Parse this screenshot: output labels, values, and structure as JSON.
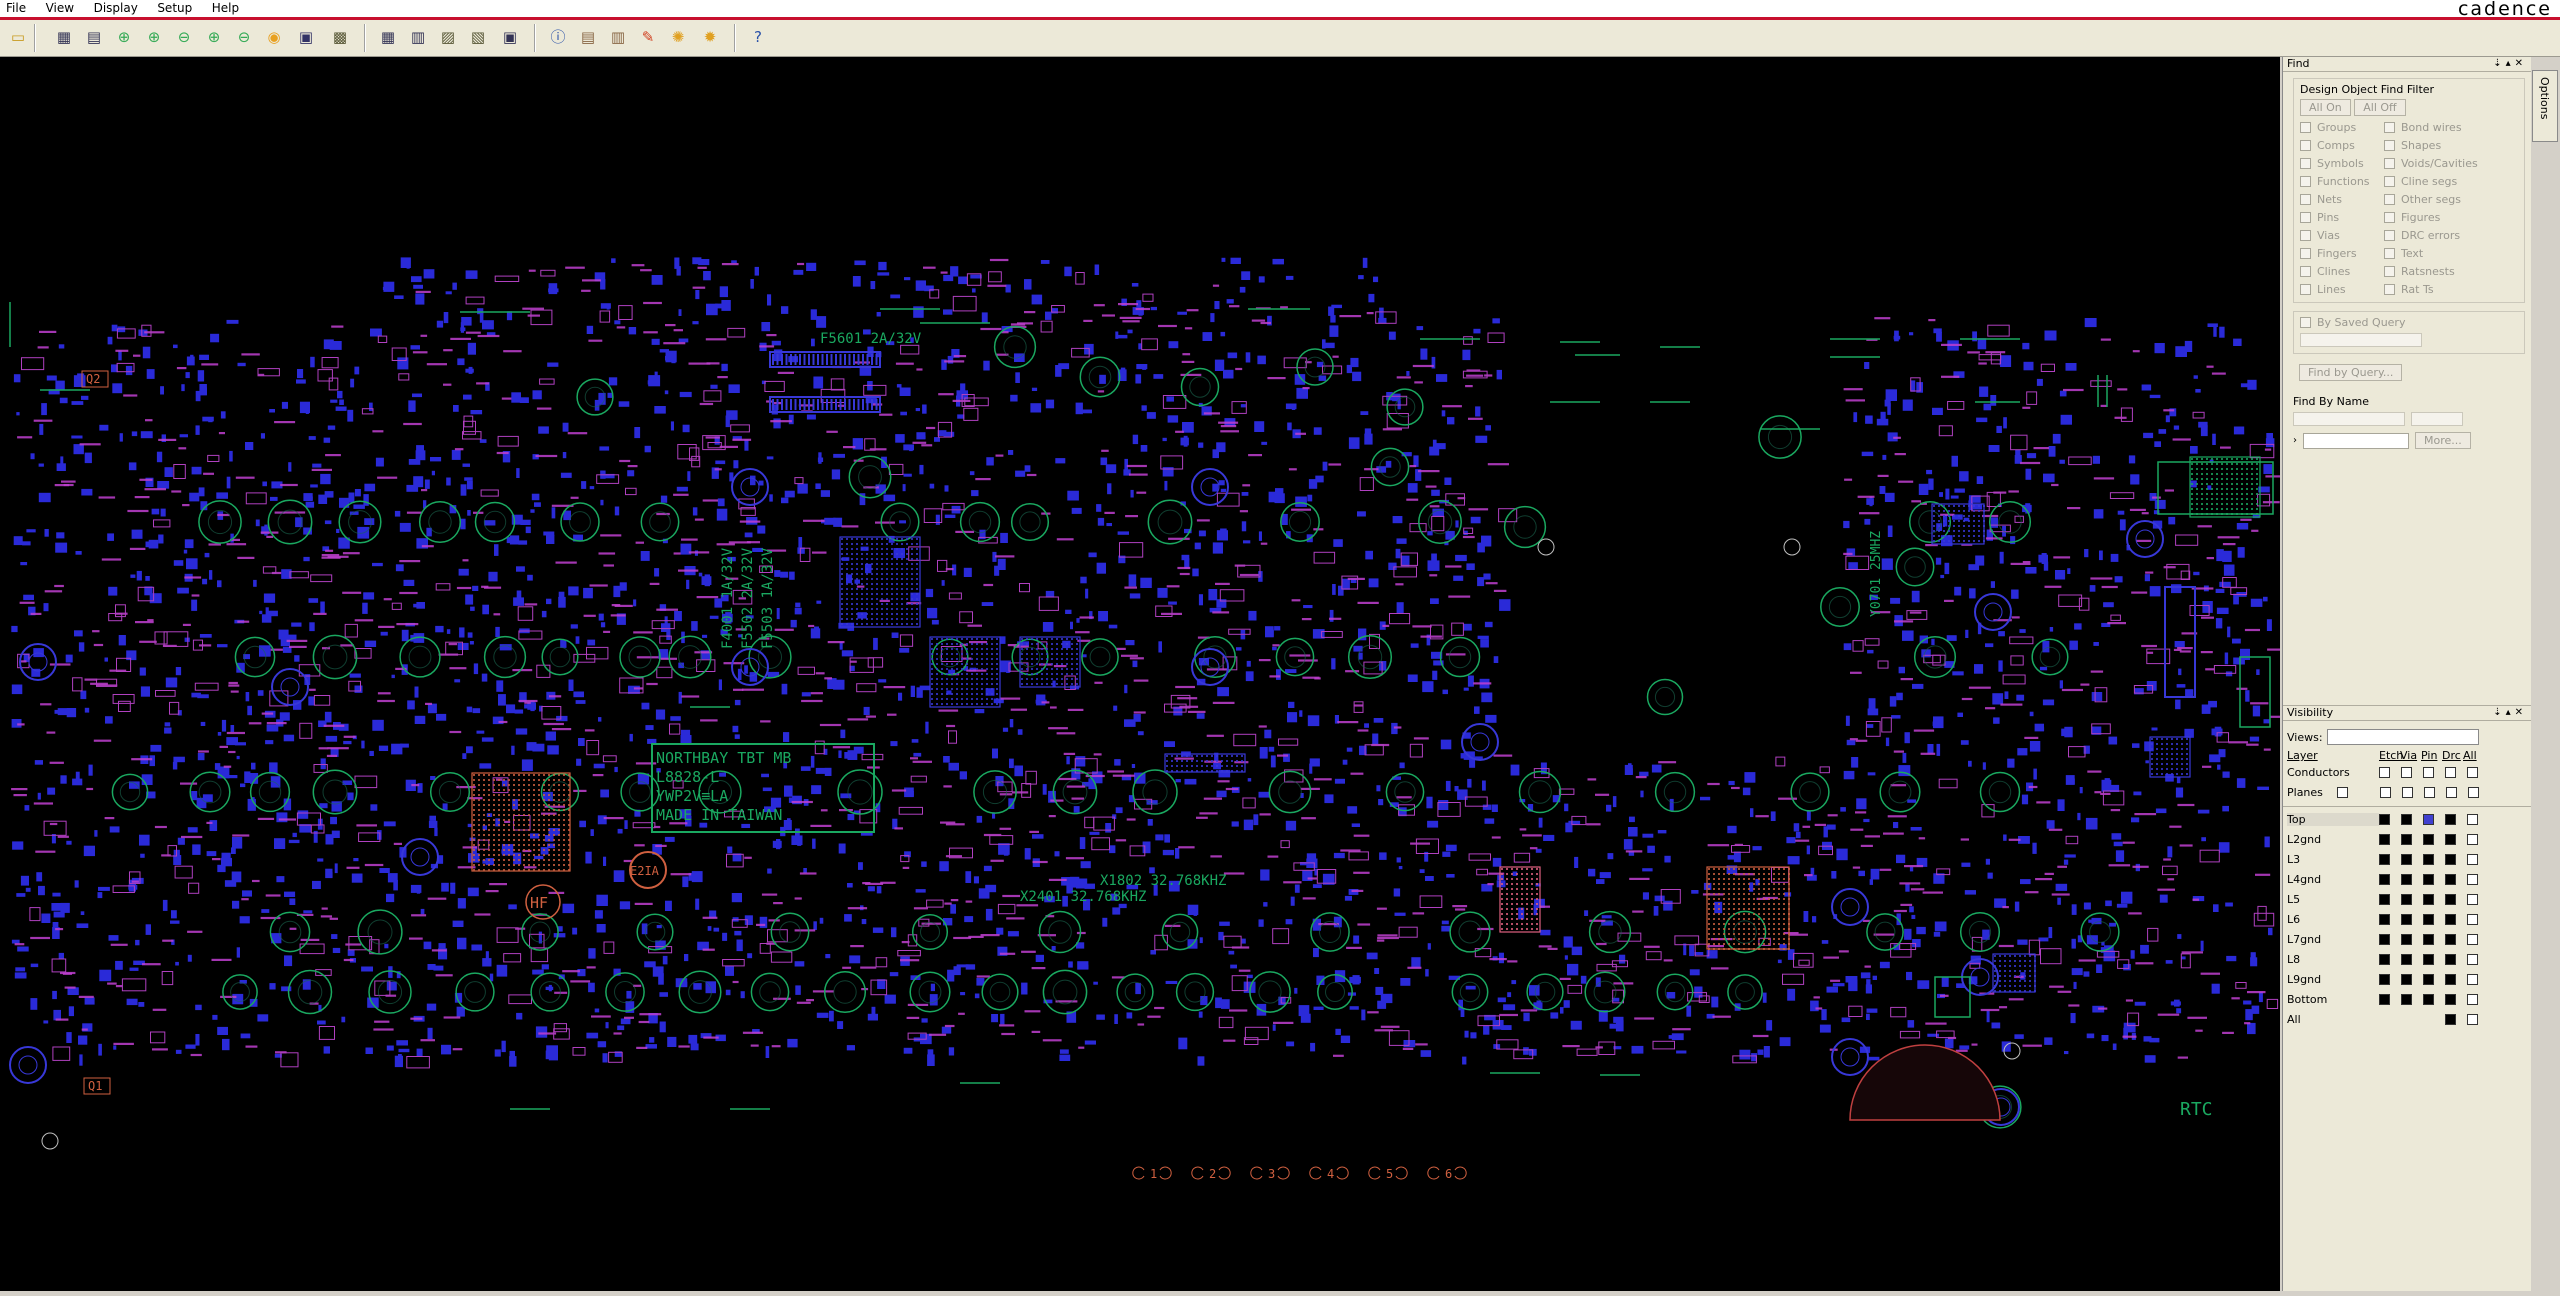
{
  "menu": [
    "File",
    "View",
    "Display",
    "Setup",
    "Help"
  ],
  "brand": "cadence",
  "toolbar_icons": [
    "open-icon",
    "grid-icon",
    "grid2-icon",
    "zoom-fit-icon",
    "zoom-in-icon",
    "zoom-out-icon",
    "zoom-world-icon",
    "zoom-prev-icon",
    "redraw-icon",
    "3d-icon",
    "color-icon",
    "grid-toggle-icon",
    "layers-icon",
    "view-icon",
    "measure-icon",
    "info-icon",
    "properties-icon",
    "reports-icon",
    "highlight-icon",
    "dehighlight-icon",
    "settings-icon",
    "help-icon"
  ],
  "board_text": {
    "fuse_top": "F5601 2A/32V",
    "fuse_col1": "F4001 1A/32V",
    "fuse_col2": "F5502 2A/32V",
    "fuse_col3": "F5503 1A/32V",
    "label_block": [
      "NORTHBAY TBT MB",
      "L8828-L",
      "YWP2V≡LA",
      "MADE IN TAIWAN"
    ],
    "xtal1": "X1802 32.768KHZ",
    "xtal2": "X2401 32.768KHZ",
    "xtal_right": "Y0701 25MHZ",
    "rtc": "RTC",
    "hf": "HF",
    "e2a": "E2IA",
    "q2": "Q2",
    "q1": "Q1",
    "nums": [
      "1",
      "2",
      "3",
      "4",
      "5",
      "6"
    ]
  },
  "find": {
    "title": "Find",
    "group_title": "Design Object Find Filter",
    "all_on": "All On",
    "all_off": "All Off",
    "left": [
      "Groups",
      "Comps",
      "Symbols",
      "Functions",
      "Nets",
      "Pins",
      "Vias",
      "Fingers",
      "Clines",
      "Lines"
    ],
    "right": [
      "Bond wires",
      "Shapes",
      "Voids/Cavities",
      "Cline segs",
      "Other segs",
      "Figures",
      "DRC errors",
      "Text",
      "Ratsnests",
      "Rat Ts"
    ],
    "saved_query": "By Saved Query",
    "find_by_query": "Find by Query...",
    "find_by_name": "Find By Name",
    "more": "More..."
  },
  "options_tab": "Options",
  "visibility": {
    "title": "Visibility",
    "views_label": "Views:",
    "headers": [
      "Layer",
      "Etch",
      "Via",
      "Pin",
      "Drc",
      "All"
    ],
    "conductors": "Conductors",
    "planes": "Planes",
    "layers": [
      "Top",
      "L2gnd",
      "L3",
      "L4gnd",
      "L5",
      "L6",
      "L7gnd",
      "L8",
      "L9gnd",
      "Bottom",
      "All"
    ]
  }
}
